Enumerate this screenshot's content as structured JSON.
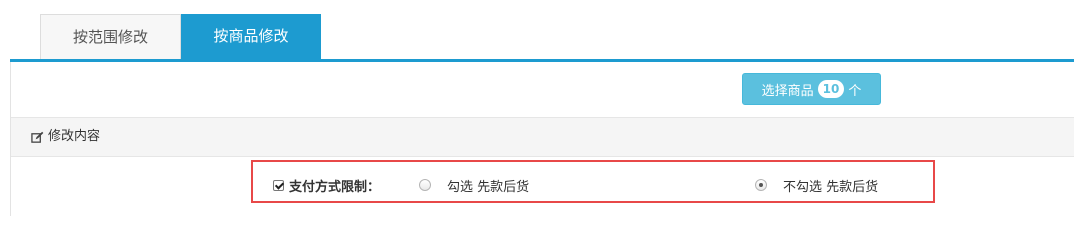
{
  "tabs": [
    {
      "label": "按范围修改",
      "active": false
    },
    {
      "label": "按商品修改",
      "active": true
    }
  ],
  "select_goods": {
    "label": "选择商品",
    "count": "10",
    "unit": "个"
  },
  "section": {
    "title": "修改内容",
    "icon": "edit-icon"
  },
  "payment_restriction": {
    "label": "支付方式限制：",
    "checked": true,
    "options": [
      {
        "label": "勾选 先款后货",
        "selected": false
      },
      {
        "label": "不勾选 先款后货",
        "selected": true
      }
    ]
  },
  "colors": {
    "accent": "#1d9bd0",
    "button": "#5bc0de",
    "highlight": "#e84848",
    "section_bg": "#f5f5f5"
  }
}
